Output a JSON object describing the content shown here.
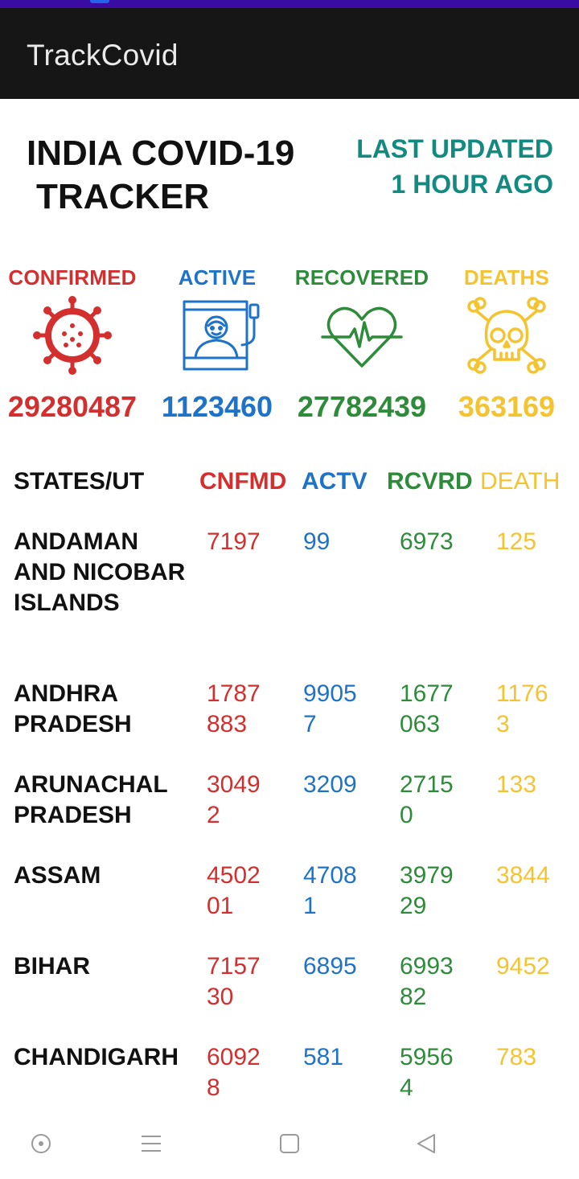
{
  "app": {
    "title": "TrackCovid"
  },
  "header": {
    "title_line1": "INDIA COVID-19",
    "title_line2": "TRACKER",
    "updated_line1": "LAST UPDATED",
    "updated_line2": "1 HOUR AGO"
  },
  "summary": [
    {
      "label": "CONFIRMED",
      "icon": "virus-icon",
      "value": "29280487",
      "color": "#d32f2f"
    },
    {
      "label": "ACTIVE",
      "icon": "hospital-bed-icon",
      "value": "1123460",
      "color": "#1e73c8"
    },
    {
      "label": "RECOVERED",
      "icon": "heartbeat-icon",
      "value": "27782439",
      "color": "#2e8b3a"
    },
    {
      "label": "DEATHS",
      "icon": "skull-crossbones-icon",
      "value": "363169",
      "color": "#f4c430"
    }
  ],
  "table": {
    "headers": {
      "state": "STATES/UT",
      "confirmed": "CNFMD",
      "active": "ACTV",
      "recovered": "RCVRD",
      "deaths": "DEATH"
    },
    "rows": [
      {
        "state": "ANDAMAN AND NICOBAR ISLANDS",
        "confirmed": "7197",
        "active": "99",
        "recovered": "6973",
        "deaths": "125"
      },
      {
        "state": "ANDHRA PRADESH",
        "confirmed": "1787883",
        "active": "99057",
        "recovered": "1677063",
        "deaths": "11763"
      },
      {
        "state": "ARUNACHAL PRADESH",
        "confirmed": "30492",
        "active": "3209",
        "recovered": "27150",
        "deaths": "133"
      },
      {
        "state": "ASSAM",
        "confirmed": "450201",
        "active": "47081",
        "recovered": "397929",
        "deaths": "3844"
      },
      {
        "state": "BIHAR",
        "confirmed": "715730",
        "active": "6895",
        "recovered": "699382",
        "deaths": "9452"
      },
      {
        "state": "CHANDIGARH",
        "confirmed": "60928",
        "active": "581",
        "recovered": "59564",
        "deaths": "783"
      }
    ]
  },
  "nav": {
    "home_icon": "circle-dot-icon",
    "menu_icon": "menu-icon",
    "recents_icon": "square-icon",
    "back_icon": "back-triangle-icon"
  }
}
